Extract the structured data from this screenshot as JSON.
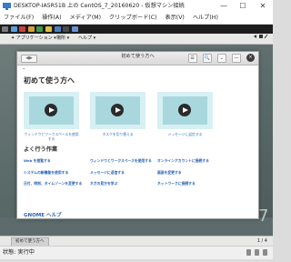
{
  "vbox": {
    "window_title": "DESKTOP-IA5R51B 上の CentOS_7_20160620 - 仮想マシン接続",
    "minimize_glyph": "—",
    "maximize_glyph": "☐",
    "close_glyph": "✕",
    "menu": [
      "ファイル(F)",
      "操作(A)",
      "メディア(M)",
      "クリップボード(C)",
      "表示(V)",
      "ヘルプ(H)"
    ],
    "status_label": "状態: 実行中"
  },
  "guest": {
    "activities": "✦ アプリケーション ▾",
    "places": "場所 ▾",
    "help_app": "ヘルプ ▾",
    "clock": "",
    "desktop_number": "7",
    "window_list_item": "初めて使う方へ",
    "workspace_pager": "1 / 4"
  },
  "help": {
    "window_title": "初めて使う方へ",
    "window_subtitle": "",
    "back_glyph": "◀▶",
    "tool_glyphs": [
      "☰",
      "🔍",
      "⌄",
      "—"
    ],
    "close_glyph": "×",
    "breadcrumb_glyph": "•",
    "heading_getting_started": "初めて使う方へ",
    "videos": [
      {
        "caption": "ウィンドウとワークスペースを使用する"
      },
      {
        "caption": "タスクを切り替える"
      },
      {
        "caption": "メッセージに返信する"
      }
    ],
    "heading_common_tasks": "よく行う作業",
    "tasks": [
      "Web を閲覧する",
      "ウィンドウとワークスペースを使用する",
      "オンラインアカウントに接続する",
      "システムの新機能を使用する",
      "メッセージに返信する",
      "画面を変更する",
      "日付、時刻、タイムゾーンを変更する",
      "ネガの見方を学ぶ",
      "ネットワークに接続する"
    ],
    "gnome_help_link": "GNOME ヘルプ"
  },
  "colors": {
    "link": "#2a62b5",
    "video_bg": "#d7f0f3",
    "video_frame": "#a9d7de",
    "desktop": "#5d6b6c"
  }
}
